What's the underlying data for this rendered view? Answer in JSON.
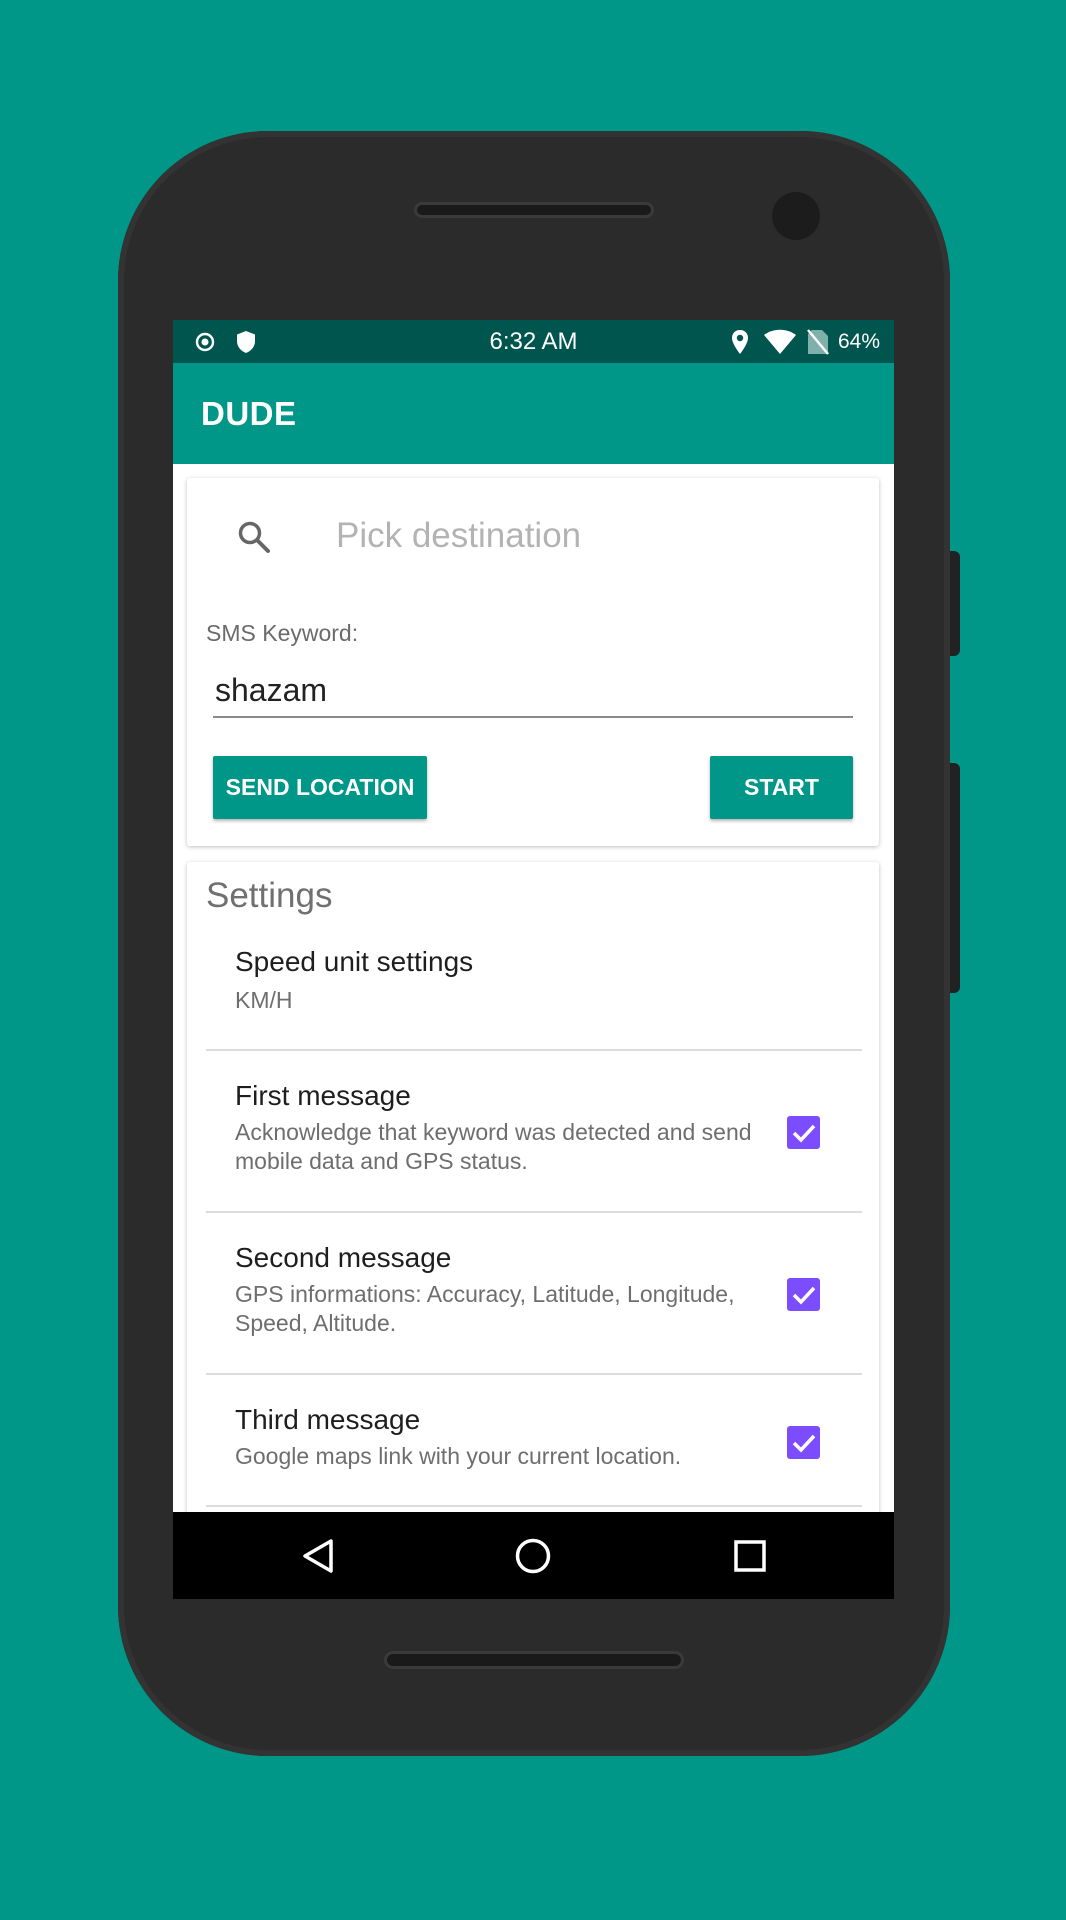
{
  "status_bar": {
    "time": "6:32 AM",
    "battery": "64%",
    "icons": [
      "target-icon",
      "shield-icon",
      "location-pin-icon",
      "wifi-icon",
      "no-sim-icon"
    ]
  },
  "app_bar": {
    "title": "DUDE"
  },
  "search": {
    "placeholder": "Pick destination"
  },
  "sms": {
    "label": "SMS Keyword:",
    "value": "shazam"
  },
  "buttons": {
    "send_location": "SEND LOCATION",
    "start": "START"
  },
  "settings": {
    "header": "Settings",
    "items": [
      {
        "title": "Speed unit settings",
        "summary": "KM/H",
        "checked": null
      },
      {
        "title": "First message",
        "summary": "Acknowledge that keyword was detected and send mobile data and GPS status.",
        "checked": true
      },
      {
        "title": "Second message",
        "summary": "GPS informations: Accuracy, Latitude, Longitude, Speed, Altitude.",
        "checked": true
      },
      {
        "title": "Third message",
        "summary": "Google maps link with your current location.",
        "checked": true
      }
    ]
  },
  "colors": {
    "background": "#009688",
    "status_bar": "#00564e",
    "primary": "#009688",
    "checkbox": "#7c4dff"
  }
}
